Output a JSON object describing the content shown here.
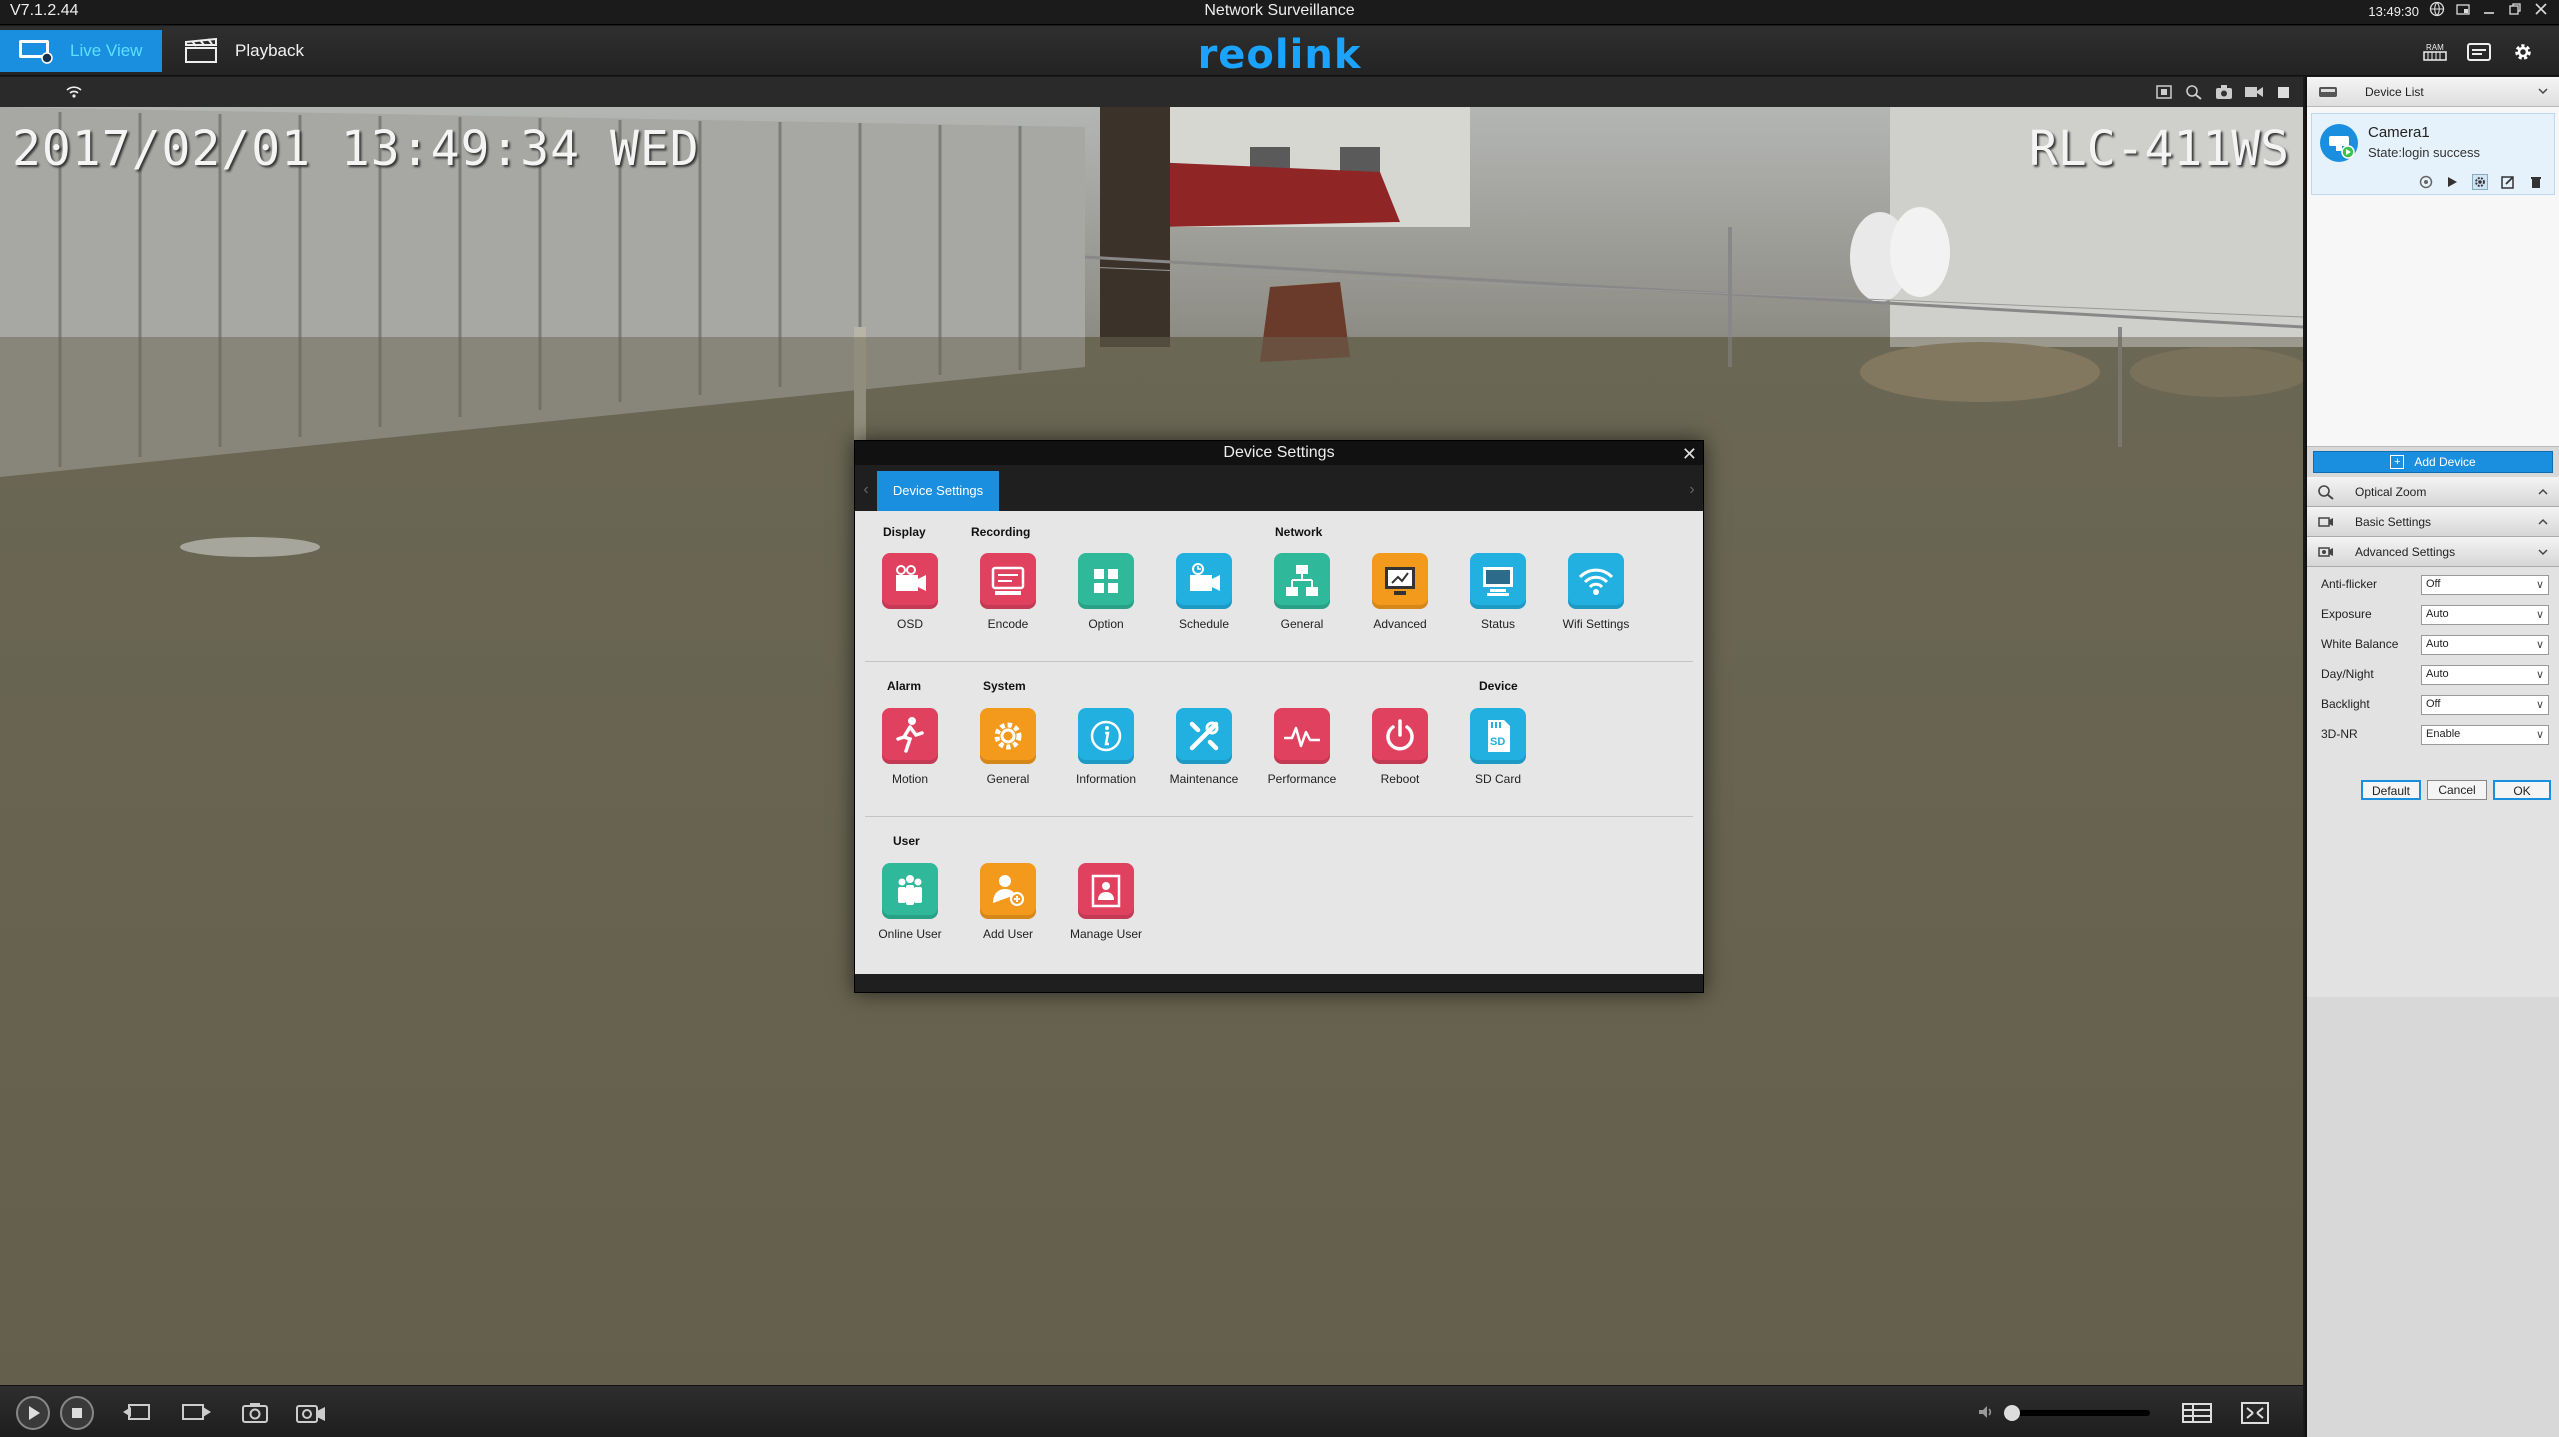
{
  "titlebar": {
    "version": "V7.1.2.44",
    "title": "Network Surveillance",
    "time": "13:49:30"
  },
  "toolbar": {
    "live_view": "Live View",
    "playback": "Playback",
    "brand": "reolink",
    "accent": "#1a8fe0"
  },
  "video": {
    "osd_time": "2017/02/01 13:49:34 WED",
    "osd_name": "RLC-411WS"
  },
  "device_list": {
    "header": "Device List",
    "camera_name": "Camera1",
    "camera_state": "State:login success",
    "add_device": "Add Device"
  },
  "sections": {
    "optical_zoom": "Optical Zoom",
    "basic_settings": "Basic Settings",
    "advanced_settings": "Advanced Settings"
  },
  "advanced": {
    "rows": [
      {
        "label": "Anti-flicker",
        "value": "Off"
      },
      {
        "label": "Exposure",
        "value": "Auto"
      },
      {
        "label": "White Balance",
        "value": "Auto"
      },
      {
        "label": "Day/Night",
        "value": "Auto"
      },
      {
        "label": "Backlight",
        "value": "Off"
      },
      {
        "label": "3D-NR",
        "value": "Enable"
      }
    ],
    "default": "Default",
    "cancel": "Cancel",
    "ok": "OK"
  },
  "dialog": {
    "title": "Device Settings",
    "tab": "Device Settings",
    "groups": {
      "display": "Display",
      "recording": "Recording",
      "network": "Network",
      "alarm": "Alarm",
      "system": "System",
      "device": "Device",
      "user": "User"
    },
    "tiles": [
      {
        "label": "OSD",
        "icon": "osd-icon",
        "color": "#e0415f"
      },
      {
        "label": "Encode",
        "icon": "encode-icon",
        "color": "#e0415f"
      },
      {
        "label": "Option",
        "icon": "option-icon",
        "color": "#2fb89a"
      },
      {
        "label": "Schedule",
        "icon": "schedule-icon",
        "color": "#21b0e0"
      },
      {
        "label": "General",
        "icon": "network-general-icon",
        "color": "#2fb89a"
      },
      {
        "label": "Advanced",
        "icon": "network-advanced-icon",
        "color": "#f39a1c"
      },
      {
        "label": "Status",
        "icon": "status-icon",
        "color": "#21b0e0"
      },
      {
        "label": "Wifi Settings",
        "icon": "wifi-icon",
        "color": "#21b0e0"
      },
      {
        "label": "Motion",
        "icon": "motion-icon",
        "color": "#e0415f"
      },
      {
        "label": "General",
        "icon": "system-general-icon",
        "color": "#f39a1c"
      },
      {
        "label": "Information",
        "icon": "information-icon",
        "color": "#21b0e0"
      },
      {
        "label": "Maintenance",
        "icon": "maintenance-icon",
        "color": "#21b0e0"
      },
      {
        "label": "Performance",
        "icon": "performance-icon",
        "color": "#e0415f"
      },
      {
        "label": "Reboot",
        "icon": "reboot-icon",
        "color": "#e0415f"
      },
      {
        "label": "SD Card",
        "icon": "sd-card-icon",
        "color": "#21b0e0"
      },
      {
        "label": "Online User",
        "icon": "online-user-icon",
        "color": "#2fb89a"
      },
      {
        "label": "Add User",
        "icon": "add-user-icon",
        "color": "#f39a1c"
      },
      {
        "label": "Manage User",
        "icon": "manage-user-icon",
        "color": "#e0415f"
      }
    ]
  }
}
